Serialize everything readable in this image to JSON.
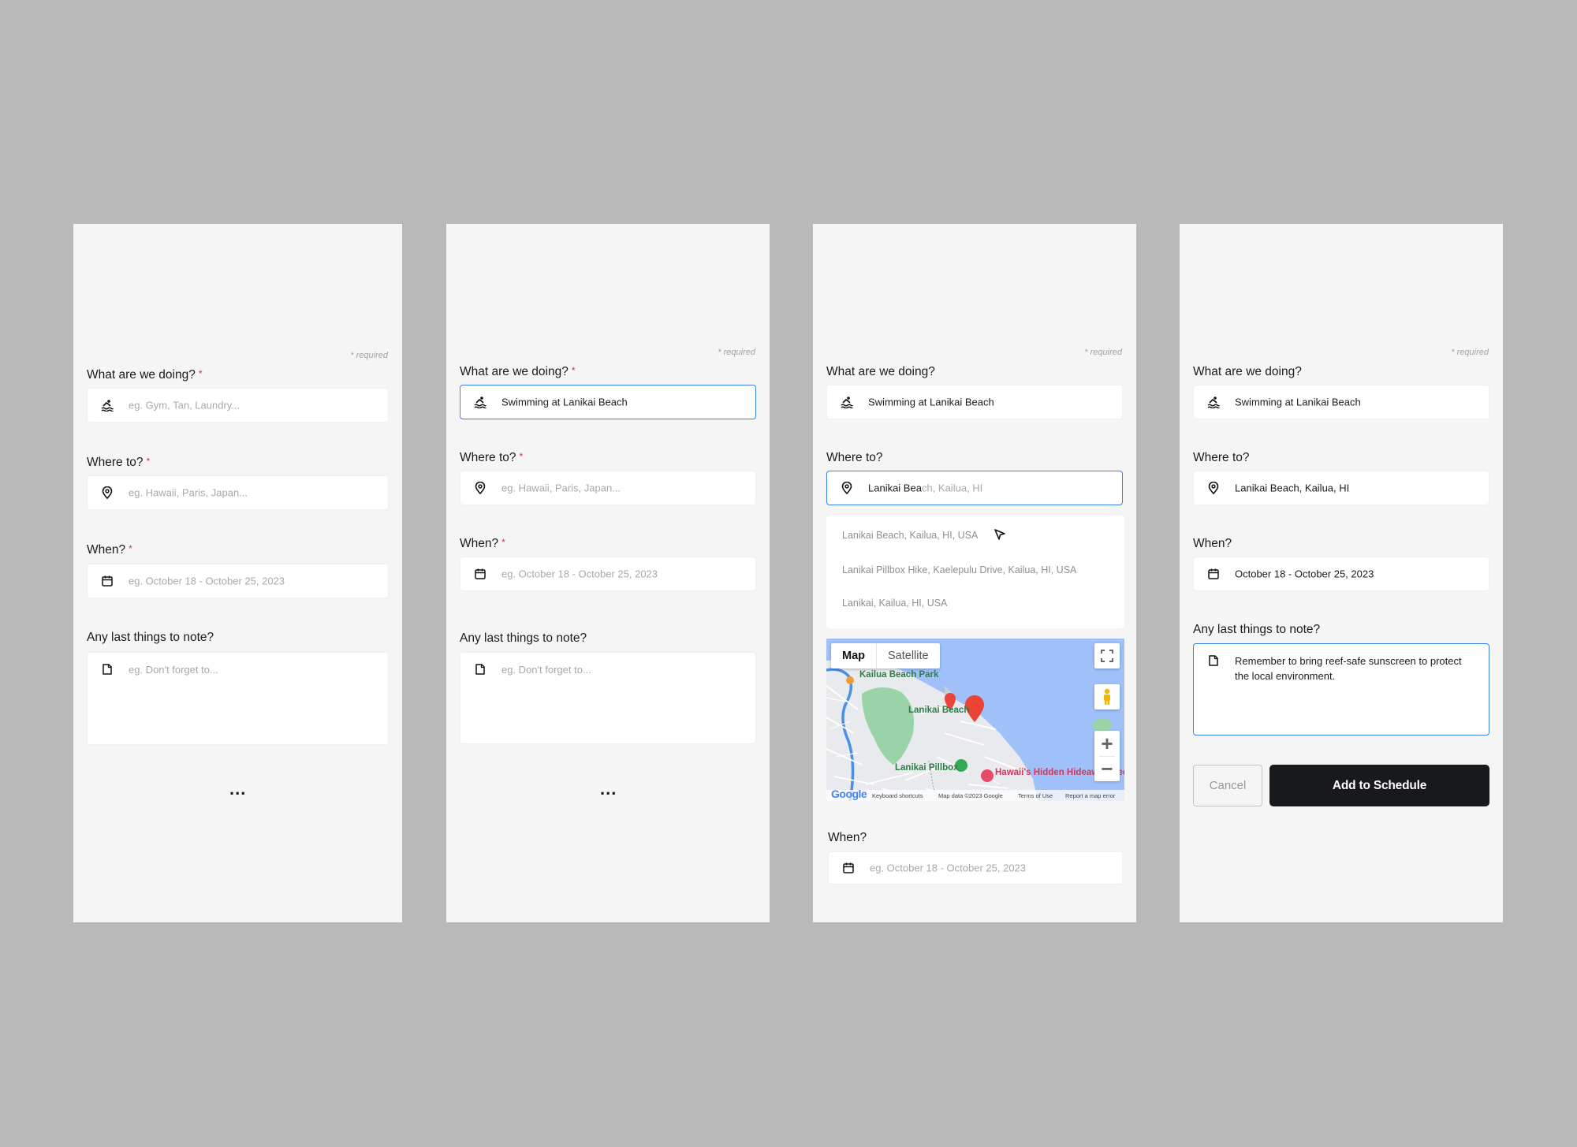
{
  "colors": {
    "background": "#b9b9b9",
    "panel": "#f5f5f5",
    "accent": "#3b82e6",
    "required": "#d62f3a",
    "primary_button": "#18191c"
  },
  "required_note": "* required",
  "form": {
    "doing_label": "What are we doing?",
    "doing_placeholder": "eg. Gym, Tan, Laundry...",
    "doing_value": "Swimming at Lanikai Beach",
    "where_label": "Where to?",
    "where_placeholder": "eg. Hawaii, Paris, Japan...",
    "where_typed": "Lanikai Bea",
    "where_suggest_suffix": "ch, Kailua, HI",
    "where_value": "Lanikai Beach, Kailua, HI",
    "when_label": "When?",
    "when_placeholder": "eg. October 18 - October 25, 2023",
    "when_value": "October 18 - October 25, 2023",
    "note_label": "Any last things to note?",
    "note_placeholder": "eg. Don't forget to...",
    "note_value": "Remember to bring reef-safe sunscreen to protect the local environment.",
    "required_mark": "*",
    "more": "...",
    "icons": {
      "doing": "swimmer-icon",
      "where": "map-pin-icon",
      "when": "calendar-icon",
      "note": "note-icon"
    }
  },
  "suggestions": [
    "Lanikai Beach, Kailua, HI, USA",
    "Lanikai Pillbox Hike, Kaelepulu Drive, Kailua, HI, USA",
    "Lanikai, Kailua, HI, USA"
  ],
  "map": {
    "tab_map": "Map",
    "tab_satellite": "Satellite",
    "label_park": "Kailua Beach Park",
    "label_beach": "Lanikai Beach",
    "label_pillbox": "Lanikai Pillbox",
    "label_poi": "Hawaii's Hidden Hideaway Bed &...",
    "zoom_in": "+",
    "zoom_out": "−",
    "logo": "Google",
    "footer_shortcuts": "Keyboard shortcuts",
    "footer_data": "Map data ©2023 Google",
    "footer_terms": "Terms of Use",
    "footer_report": "Report a map error"
  },
  "actions": {
    "cancel": "Cancel",
    "add": "Add to Schedule"
  }
}
